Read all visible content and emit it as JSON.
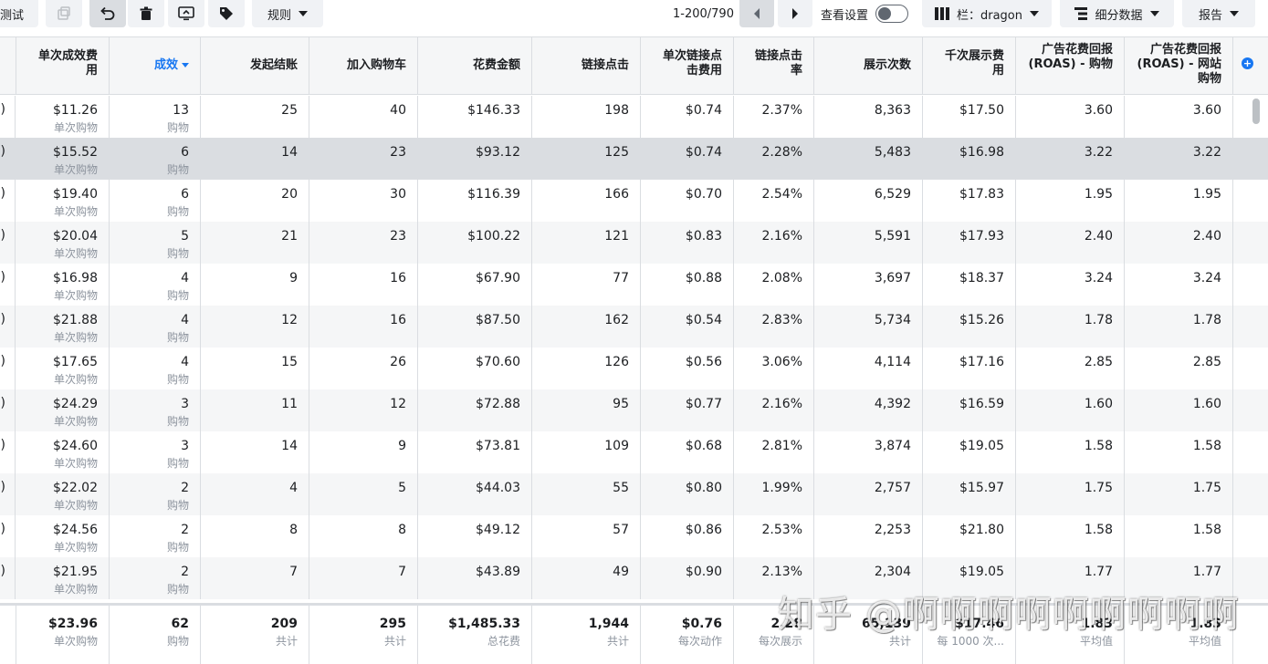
{
  "toolbar": {
    "test_label": "测试",
    "rules_label": "规则",
    "pagination": "1-200/790",
    "view_settings_label": "查看设置",
    "columns_label": "栏：dragon",
    "breakdown_label": "细分数据",
    "reports_label": "报告"
  },
  "columns": [
    {
      "key": "cpr",
      "label": "单次成效费用"
    },
    {
      "key": "results",
      "label": "成效"
    },
    {
      "key": "checkouts",
      "label": "发起结账"
    },
    {
      "key": "add_to_cart",
      "label": "加入购物车"
    },
    {
      "key": "spend",
      "label": "花费金额"
    },
    {
      "key": "link_clicks",
      "label": "链接点击"
    },
    {
      "key": "cpc",
      "label": "单次链接点击费用"
    },
    {
      "key": "ctr",
      "label": "链接点击率"
    },
    {
      "key": "impressions",
      "label": "展示次数"
    },
    {
      "key": "cpm",
      "label": "千次展示费用"
    },
    {
      "key": "roas",
      "label": "广告花费回报 (ROAS) - 购物"
    },
    {
      "key": "roas_web",
      "label": "广告花费回报 (ROAS) - 网站购物"
    }
  ],
  "rows": [
    {
      "frag": ")",
      "cpr": "$11.26",
      "cpr_sub": "单次购物",
      "results": "13",
      "results_sub": "购物",
      "checkouts": "25",
      "add_to_cart": "40",
      "spend": "$146.33",
      "link_clicks": "198",
      "cpc": "$0.74",
      "ctr": "2.37%",
      "impressions": "8,363",
      "cpm": "$17.50",
      "roas": "3.60",
      "roas_web": "3.60"
    },
    {
      "frag": ")",
      "cpr": "$15.52",
      "cpr_sub": "单次购物",
      "results": "6",
      "results_sub": "购物",
      "checkouts": "14",
      "add_to_cart": "23",
      "spend": "$93.12",
      "link_clicks": "125",
      "cpc": "$0.74",
      "ctr": "2.28%",
      "impressions": "5,483",
      "cpm": "$16.98",
      "roas": "3.22",
      "roas_web": "3.22"
    },
    {
      "frag": ")",
      "cpr": "$19.40",
      "cpr_sub": "单次购物",
      "results": "6",
      "results_sub": "购物",
      "checkouts": "20",
      "add_to_cart": "30",
      "spend": "$116.39",
      "link_clicks": "166",
      "cpc": "$0.70",
      "ctr": "2.54%",
      "impressions": "6,529",
      "cpm": "$17.83",
      "roas": "1.95",
      "roas_web": "1.95"
    },
    {
      "frag": ")",
      "cpr": "$20.04",
      "cpr_sub": "单次购物",
      "results": "5",
      "results_sub": "购物",
      "checkouts": "21",
      "add_to_cart": "23",
      "spend": "$100.22",
      "link_clicks": "121",
      "cpc": "$0.83",
      "ctr": "2.16%",
      "impressions": "5,591",
      "cpm": "$17.93",
      "roas": "2.40",
      "roas_web": "2.40"
    },
    {
      "frag": ")",
      "cpr": "$16.98",
      "cpr_sub": "单次购物",
      "results": "4",
      "results_sub": "购物",
      "checkouts": "9",
      "add_to_cart": "16",
      "spend": "$67.90",
      "link_clicks": "77",
      "cpc": "$0.88",
      "ctr": "2.08%",
      "impressions": "3,697",
      "cpm": "$18.37",
      "roas": "3.24",
      "roas_web": "3.24"
    },
    {
      "frag": ")",
      "cpr": "$21.88",
      "cpr_sub": "单次购物",
      "results": "4",
      "results_sub": "购物",
      "checkouts": "12",
      "add_to_cart": "16",
      "spend": "$87.50",
      "link_clicks": "162",
      "cpc": "$0.54",
      "ctr": "2.83%",
      "impressions": "5,734",
      "cpm": "$15.26",
      "roas": "1.78",
      "roas_web": "1.78"
    },
    {
      "frag": ")",
      "cpr": "$17.65",
      "cpr_sub": "单次购物",
      "results": "4",
      "results_sub": "购物",
      "checkouts": "15",
      "add_to_cart": "26",
      "spend": "$70.60",
      "link_clicks": "126",
      "cpc": "$0.56",
      "ctr": "3.06%",
      "impressions": "4,114",
      "cpm": "$17.16",
      "roas": "2.85",
      "roas_web": "2.85"
    },
    {
      "frag": ")",
      "cpr": "$24.29",
      "cpr_sub": "单次购物",
      "results": "3",
      "results_sub": "购物",
      "checkouts": "11",
      "add_to_cart": "12",
      "spend": "$72.88",
      "link_clicks": "95",
      "cpc": "$0.77",
      "ctr": "2.16%",
      "impressions": "4,392",
      "cpm": "$16.59",
      "roas": "1.60",
      "roas_web": "1.60"
    },
    {
      "frag": ")",
      "cpr": "$24.60",
      "cpr_sub": "单次购物",
      "results": "3",
      "results_sub": "购物",
      "checkouts": "14",
      "add_to_cart": "9",
      "spend": "$73.81",
      "link_clicks": "109",
      "cpc": "$0.68",
      "ctr": "2.81%",
      "impressions": "3,874",
      "cpm": "$19.05",
      "roas": "1.58",
      "roas_web": "1.58"
    },
    {
      "frag": ")",
      "cpr": "$22.02",
      "cpr_sub": "单次购物",
      "results": "2",
      "results_sub": "购物",
      "checkouts": "4",
      "add_to_cart": "5",
      "spend": "$44.03",
      "link_clicks": "55",
      "cpc": "$0.80",
      "ctr": "1.99%",
      "impressions": "2,757",
      "cpm": "$15.97",
      "roas": "1.75",
      "roas_web": "1.75"
    },
    {
      "frag": ")",
      "cpr": "$24.56",
      "cpr_sub": "单次购物",
      "results": "2",
      "results_sub": "购物",
      "checkouts": "8",
      "add_to_cart": "8",
      "spend": "$49.12",
      "link_clicks": "57",
      "cpc": "$0.86",
      "ctr": "2.53%",
      "impressions": "2,253",
      "cpm": "$21.80",
      "roas": "1.58",
      "roas_web": "1.58"
    },
    {
      "frag": ")",
      "cpr": "$21.95",
      "cpr_sub": "单次购物",
      "results": "2",
      "results_sub": "购物",
      "checkouts": "7",
      "add_to_cart": "7",
      "spend": "$43.89",
      "link_clicks": "49",
      "cpc": "$0.90",
      "ctr": "2.13%",
      "impressions": "2,304",
      "cpm": "$19.05",
      "roas": "1.77",
      "roas_web": "1.77"
    }
  ],
  "totals": {
    "cpr": "$23.96",
    "cpr_sub": "单次购物",
    "results": "62",
    "results_sub": "购物",
    "checkouts": "209",
    "checkouts_sub": "共计",
    "add_to_cart": "295",
    "add_to_cart_sub": "共计",
    "spend": "$1,485.33",
    "spend_sub": "总花费",
    "link_clicks": "1,944",
    "link_clicks_sub": "共计",
    "cpc": "$0.76",
    "cpc_sub": "每次动作",
    "ctr": "2.28",
    "ctr_sub": "每次展示",
    "impressions": "65,139",
    "impressions_sub": "共计",
    "cpm": "$17.46",
    "cpm_sub": "每 1000 次...",
    "roas": "1.83",
    "roas_sub": "平均值",
    "roas_web": "1.83",
    "roas_web_sub": "平均值"
  },
  "watermark": "知乎 @啊啊啊啊啊啊啊啊啊",
  "colors": {
    "accent": "#1877f2",
    "header_bg": "#f5f6f7",
    "highlight": "#dadde1"
  }
}
